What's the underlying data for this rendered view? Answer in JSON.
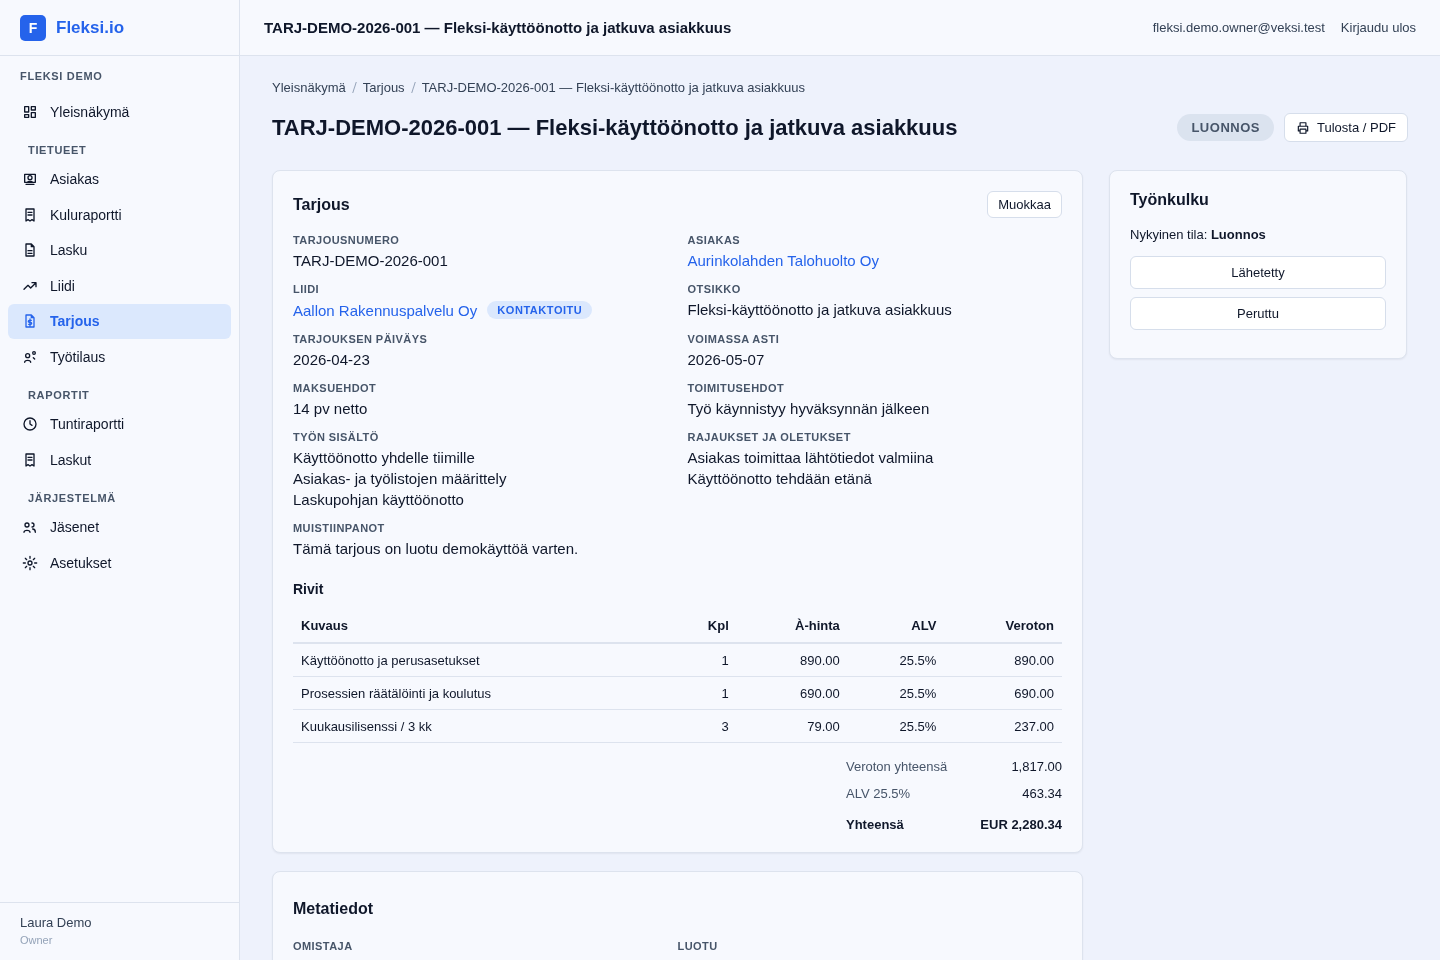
{
  "brand": {
    "logo_letter": "F",
    "name": "Fleksi.io"
  },
  "workspace": "FLEKSI DEMO",
  "sidebar": {
    "sections": [
      {
        "items": [
          {
            "label": "Yleisnäkymä",
            "selected": false
          }
        ]
      },
      {
        "title": "TIETUEET",
        "items": [
          {
            "label": "Asiakas",
            "selected": false
          },
          {
            "label": "Kuluraportti",
            "selected": false
          },
          {
            "label": "Lasku",
            "selected": false
          },
          {
            "label": "Liidi",
            "selected": false
          },
          {
            "label": "Tarjous",
            "selected": true
          },
          {
            "label": "Työtilaus",
            "selected": false
          }
        ]
      },
      {
        "title": "RAPORTIT",
        "items": [
          {
            "label": "Tuntiraportti",
            "selected": false
          },
          {
            "label": "Laskut",
            "selected": false
          }
        ]
      },
      {
        "title": "JÄRJESTELMÄ",
        "items": [
          {
            "label": "Jäsenet",
            "selected": false
          },
          {
            "label": "Asetukset",
            "selected": false
          }
        ]
      }
    ],
    "user": {
      "name": "Laura Demo",
      "role": "Owner"
    }
  },
  "header": {
    "title": "TARJ-DEMO-2026-001 — Fleksi-käyttöönotto ja jatkuva asiakkuus",
    "email": "fleksi.demo.owner@veksi.test",
    "logout": "Kirjaudu ulos"
  },
  "breadcrumbs": [
    "Yleisnäkymä",
    "Tarjous",
    "TARJ-DEMO-2026-001 — Fleksi-käyttöönotto ja jatkuva asiakkuus"
  ],
  "page": {
    "title": "TARJ-DEMO-2026-001 — Fleksi-käyttöönotto ja jatkuva asiakkuus",
    "status": "LUONNOS",
    "print_button": "Tulosta / PDF"
  },
  "offer_card": {
    "title": "Tarjous",
    "edit_button": "Muokkaa",
    "fields": [
      {
        "label": "TARJOUSNUMERO",
        "kind": "text",
        "lines": [
          "TARJ-DEMO-2026-001"
        ]
      },
      {
        "label": "ASIAKAS",
        "kind": "link",
        "lines": [
          "Aurinkolahden Talohuolto Oy"
        ]
      },
      {
        "label": "LIIDI",
        "kind": "link",
        "lines": [
          "Aallon Rakennuspalvelu Oy"
        ],
        "badge": "KONTAKTOITU"
      },
      {
        "label": "OTSIKKO",
        "kind": "text",
        "lines": [
          "Fleksi-käyttöönotto ja jatkuva asiakkuus"
        ]
      },
      {
        "label": "TARJOUKSEN PÄIVÄYS",
        "kind": "text",
        "lines": [
          "2026-04-23"
        ]
      },
      {
        "label": "VOIMASSA ASTI",
        "kind": "text",
        "lines": [
          "2026-05-07"
        ]
      },
      {
        "label": "MAKSUEHDOT",
        "kind": "text",
        "lines": [
          "14 pv netto"
        ]
      },
      {
        "label": "TOIMITUSEHDOT",
        "kind": "text",
        "lines": [
          "Työ käynnistyy hyväksynnän jälkeen"
        ]
      },
      {
        "label": "TYÖN SISÄLTÖ",
        "kind": "text",
        "lines": [
          "Käyttöönotto yhdelle tiimille",
          "Asiakas- ja työlistojen määrittely",
          "Laskupohjan käyttöönotto"
        ]
      },
      {
        "label": "RAJAUKSET JA OLETUKSET",
        "kind": "text",
        "lines": [
          "Asiakas toimittaa lähtötiedot valmiina",
          "Käyttöönotto tehdään etänä"
        ]
      },
      {
        "label": "MUISTIINPANOT",
        "kind": "text",
        "lines": [
          "Tämä tarjous on luotu demokäyttöä varten."
        ]
      }
    ],
    "rows_title": "Rivit",
    "table": {
      "columns": [
        "Kuvaus",
        "Kpl",
        "À-hinta",
        "ALV",
        "Veroton"
      ],
      "rows": [
        [
          "Käyttöönotto ja perusasetukset",
          "1",
          "890.00",
          "25.5%",
          "890.00"
        ],
        [
          "Prosessien räätälöinti ja koulutus",
          "1",
          "690.00",
          "25.5%",
          "690.00"
        ],
        [
          "Kuukausilisenssi / 3 kk",
          "3",
          "79.00",
          "25.5%",
          "237.00"
        ]
      ]
    },
    "totals": [
      {
        "label": "Veroton yhteensä",
        "value": "1,817.00",
        "kind": "subtotal"
      },
      {
        "label": "ALV 25.5%",
        "value": "463.34",
        "kind": "subtotal"
      },
      {
        "label": "Yhteensä",
        "value": "EUR 2,280.34",
        "kind": "total"
      }
    ]
  },
  "workflow": {
    "title": "Työnkulku",
    "state_label": "Nykyinen tila:",
    "state": "Luonnos",
    "buttons": [
      "Lähetetty",
      "Peruttu"
    ]
  },
  "meta_card": {
    "title": "Metatiedot",
    "labels": [
      "OMISTAJA",
      "LUOTU"
    ]
  }
}
